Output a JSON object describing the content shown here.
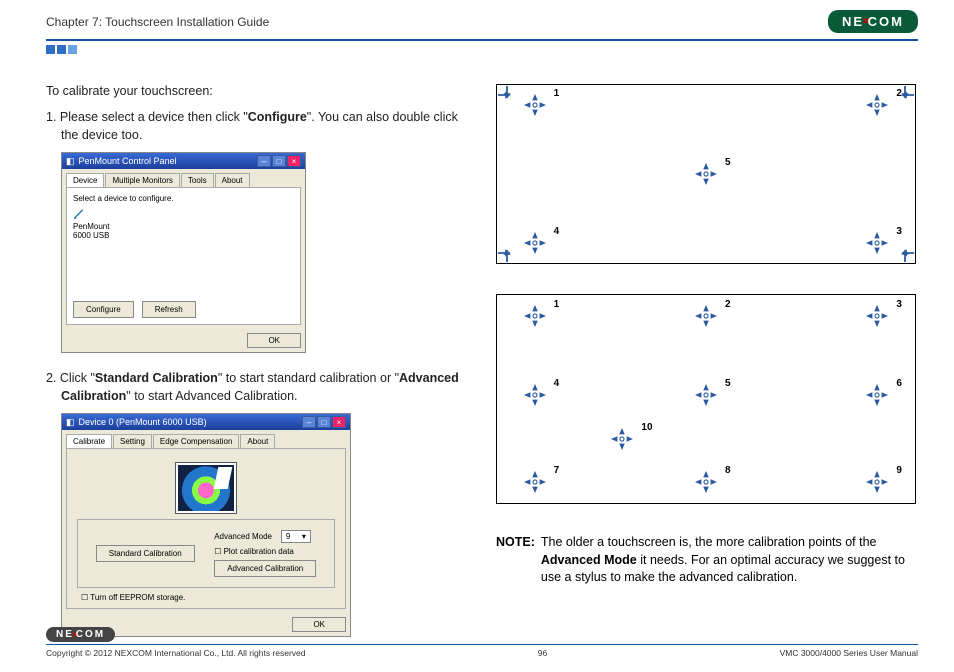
{
  "header": {
    "chapter": "Chapter 7: Touchscreen Installation Guide",
    "brand": "NEXCOM"
  },
  "intro": "To calibrate your touchscreen:",
  "steps": {
    "s1_pre": "1. Please select a device then click \"",
    "s1_bold": "Configure",
    "s1_post": "\". You can also double click the device too.",
    "s2_pre": "2. Click \"",
    "s2_b1": "Standard Calibration",
    "s2_mid": "\" to start standard calibration or \"",
    "s2_b2": "Advanced Calibration",
    "s2_post": "\" to start Advanced Calibration."
  },
  "dlg1": {
    "title": "PenMount Control Panel",
    "tabs": [
      "Device",
      "Multiple Monitors",
      "Tools",
      "About"
    ],
    "hint": "Select a device to configure.",
    "device_line1": "PenMount",
    "device_line2": "6000 USB",
    "btn_configure": "Configure",
    "btn_refresh": "Refresh",
    "btn_ok": "OK"
  },
  "dlg2": {
    "title": "Device 0 (PenMount 6000 USB)",
    "tabs": [
      "Calibrate",
      "Setting",
      "Edge Compensation",
      "About"
    ],
    "btn_std": "Standard Calibration",
    "adv_label": "Advanced Mode",
    "adv_value": "9",
    "plot_chk": "Plot calibration data",
    "btn_adv": "Advanced Calibration",
    "eeprom_chk": "Turn off EEPROM storage.",
    "btn_ok": "OK"
  },
  "calib5": {
    "labels": [
      "1",
      "2",
      "3",
      "4",
      "5"
    ]
  },
  "calib10": {
    "labels": [
      "1",
      "2",
      "3",
      "4",
      "5",
      "6",
      "7",
      "8",
      "9",
      "10"
    ]
  },
  "note": {
    "lead": "NOTE:",
    "body_pre": "The older a touchscreen is, the more calibration points of the ",
    "body_bold": "Advanced Mode",
    "body_post": " it needs. For an optimal accuracy we suggest to use a stylus to make the advanced calibration."
  },
  "footer": {
    "copyright": "Copyright © 2012 NEXCOM International Co., Ltd. All rights reserved",
    "page": "96",
    "manual": "VMC 3000/4000 Series User Manual"
  }
}
